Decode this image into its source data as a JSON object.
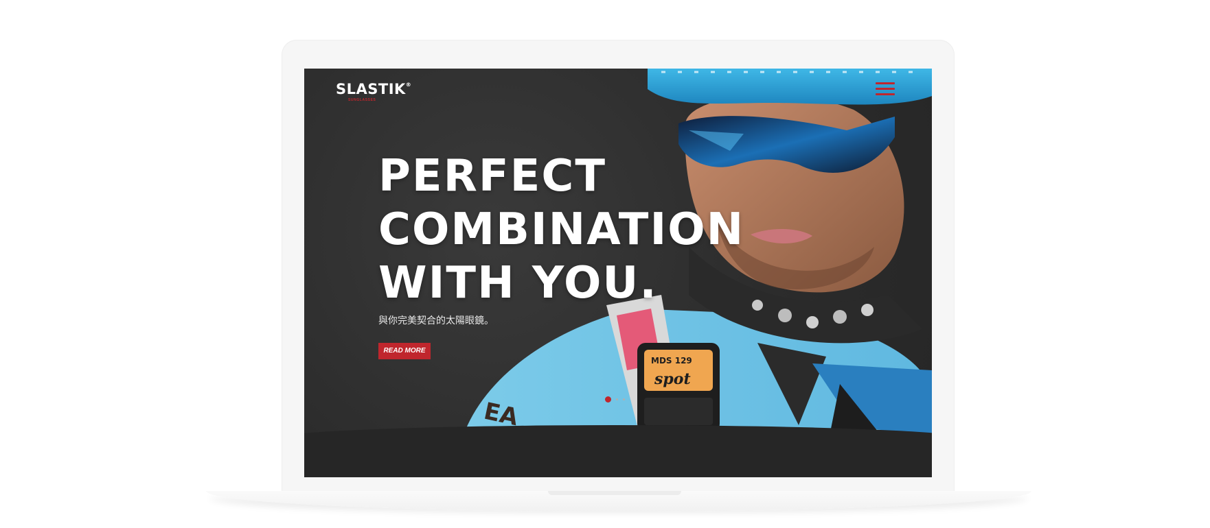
{
  "header": {
    "logo_text": "SLASTIK",
    "logo_reg": "®",
    "logo_sub": "SUNGLASSES",
    "menu_icon": "hamburger-menu-icon"
  },
  "hero": {
    "title_lines": [
      "PERFECT",
      "COMBINATION",
      "WITH YOU."
    ],
    "subtitle": "與你完美契合的太陽眼鏡。",
    "button_label": "READ MORE",
    "image_description_icon": "cyclist-photo"
  },
  "slider": {
    "slide_count": 3,
    "active_index": 0
  },
  "colors": {
    "accent": "#c0262d",
    "background": "#2e2e2e",
    "helmet": "#2aa6d8",
    "jersey": "#6fc1e6"
  }
}
